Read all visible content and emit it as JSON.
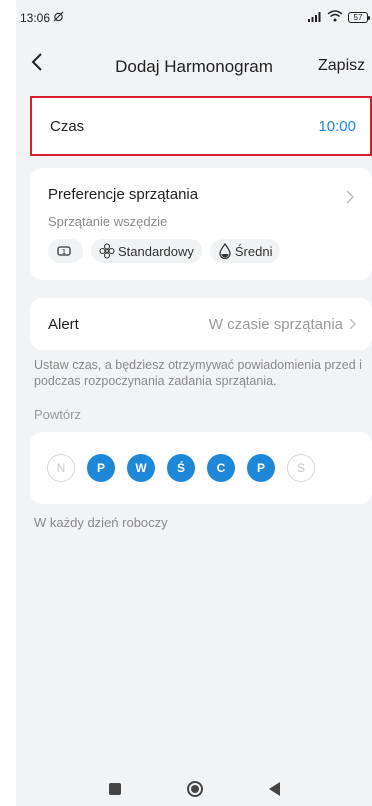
{
  "status_bar": {
    "time": "13:06",
    "battery": "57",
    "icons": [
      "alarm-off-icon",
      "signal-icon",
      "wifi-icon",
      "battery-icon"
    ]
  },
  "header": {
    "title": "Dodaj Harmonogram",
    "save_label": "Zapisz",
    "back_icon": "chevron-left-icon"
  },
  "time_row": {
    "label": "Czas",
    "value": "10:00"
  },
  "preferences": {
    "title": "Preferencje sprzątania",
    "subtitle": "Sprzątanie wszędzie",
    "chips": [
      {
        "icon": "cycle-icon",
        "label": ""
      },
      {
        "icon": "fan-icon",
        "label": "Standardowy"
      },
      {
        "icon": "water-drop-icon",
        "label": "Średni"
      }
    ]
  },
  "alert": {
    "label": "Alert",
    "value": "W czasie sprzątania"
  },
  "info_text": "Ustaw czas, a będziesz otrzymywać powiadomienia przed i podczas rozpoczynania zadania sprzątania.",
  "repeat": {
    "label": "Powtórz",
    "days": [
      {
        "letter": "N",
        "active": false
      },
      {
        "letter": "P",
        "active": true
      },
      {
        "letter": "W",
        "active": true
      },
      {
        "letter": "Ś",
        "active": true
      },
      {
        "letter": "C",
        "active": true
      },
      {
        "letter": "P",
        "active": true
      },
      {
        "letter": "S",
        "active": false
      }
    ],
    "summary": "W każdy dzień roboczy"
  },
  "colors": {
    "accent": "#1e88d6",
    "highlight_border": "#d81e2a",
    "background": "#f2f3f5"
  }
}
